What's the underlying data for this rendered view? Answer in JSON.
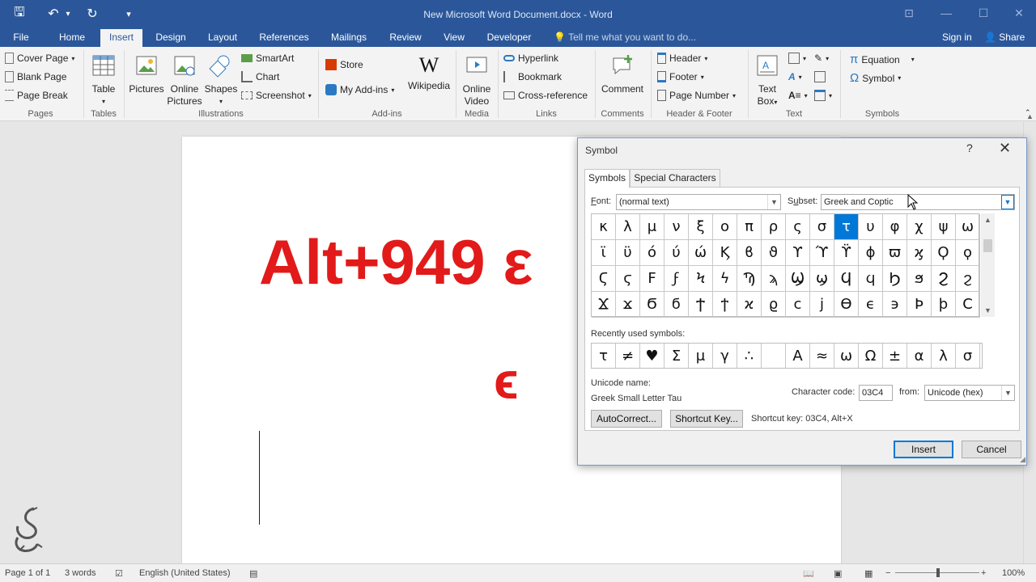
{
  "window": {
    "title": "New Microsoft Word Document.docx - Word"
  },
  "qat": {
    "save": "🖫",
    "undo": "↶",
    "redo": "↻",
    "customize": "▾"
  },
  "tabs": [
    "File",
    "Home",
    "Insert",
    "Design",
    "Layout",
    "References",
    "Mailings",
    "Review",
    "View",
    "Developer"
  ],
  "tell_me": "Tell me what you want to do...",
  "sign_in": "Sign in",
  "share": "Share",
  "ribbon": {
    "pages": {
      "label": "Pages",
      "cover_page": "Cover Page",
      "blank_page": "Blank Page",
      "page_break": "Page Break"
    },
    "tables": {
      "label": "Tables",
      "table": "Table"
    },
    "illustrations": {
      "label": "Illustrations",
      "pictures": "Pictures",
      "online_pictures_1": "Online",
      "online_pictures_2": "Pictures",
      "shapes": "Shapes",
      "smartart": "SmartArt",
      "chart": "Chart",
      "screenshot": "Screenshot"
    },
    "addins": {
      "label": "Add-ins",
      "store": "Store",
      "my_addins": "My Add-ins",
      "wikipedia": "Wikipedia"
    },
    "media": {
      "label": "Media",
      "online_video_1": "Online",
      "online_video_2": "Video"
    },
    "links": {
      "label": "Links",
      "hyperlink": "Hyperlink",
      "bookmark": "Bookmark",
      "cross_reference": "Cross-reference"
    },
    "comments": {
      "label": "Comments",
      "comment": "Comment"
    },
    "header_footer": {
      "label": "Header & Footer",
      "header": "Header",
      "footer": "Footer",
      "page_number": "Page Number"
    },
    "text": {
      "label": "Text",
      "text_box_1": "Text",
      "text_box_2": "Box"
    },
    "symbols": {
      "label": "Symbols",
      "equation": "Equation",
      "symbol": "Symbol"
    }
  },
  "document": {
    "line1": "Alt+949 ε",
    "line2": "ϵ"
  },
  "dialog": {
    "title": "Symbol",
    "help": "?",
    "close": "✕",
    "tabs": [
      "Symbols",
      "Special Characters"
    ],
    "font_label": "Font:",
    "font_value": "(normal text)",
    "subset_label": "Subset:",
    "subset_value": "Greek and Coptic",
    "grid": [
      [
        "κ",
        "λ",
        "μ",
        "ν",
        "ξ",
        "ο",
        "π",
        "ρ",
        "ς",
        "σ",
        "τ",
        "υ",
        "φ",
        "χ",
        "ψ",
        "ω"
      ],
      [
        "ϊ",
        "ϋ",
        "ό",
        "ύ",
        "ώ",
        "Ϗ",
        "ϐ",
        "ϑ",
        "ϒ",
        "ϓ",
        "ϔ",
        "ϕ",
        "ϖ",
        "ϗ",
        "Ϙ",
        "ϙ"
      ],
      [
        "Ϛ",
        "ϛ",
        "Ϝ",
        "ϝ",
        "Ϟ",
        "ϟ",
        "Ϡ",
        "ϡ",
        "Ϣ",
        "ϣ",
        "Ϥ",
        "ϥ",
        "Ϧ",
        "ϧ",
        "Ϩ",
        "ϩ"
      ],
      [
        "Ϫ",
        "ϫ",
        "Ϭ",
        "ϭ",
        "Ϯ",
        "ϯ",
        "ϰ",
        "ϱ",
        "ϲ",
        "ϳ",
        "ϴ",
        "ϵ",
        "϶",
        "Ϸ",
        "ϸ",
        "Ϲ"
      ]
    ],
    "selected_symbol": "τ",
    "recent_label": "Recently used symbols:",
    "recent": [
      "τ",
      "≠",
      "♥",
      "Σ",
      "μ",
      "γ",
      "∴",
      "",
      "Α",
      "≈",
      "ω",
      "Ω",
      "±",
      "α",
      "λ",
      "σ"
    ],
    "unicode_name_label": "Unicode name:",
    "unicode_name": "Greek Small Letter Tau",
    "char_code_label": "Character code:",
    "char_code": "03C4",
    "from_label": "from:",
    "from_value": "Unicode (hex)",
    "autocorrect": "AutoCorrect...",
    "shortcut_key_btn": "Shortcut Key...",
    "shortcut_text": "Shortcut key: 03C4, Alt+X",
    "insert": "Insert",
    "cancel": "Cancel"
  },
  "status": {
    "page": "Page 1 of 1",
    "words": "3 words",
    "language": "English (United States)",
    "zoom": "100%"
  },
  "colors": {
    "brand": "#2b579a",
    "accent": "#0078d7",
    "doc_text": "#e21a1a"
  }
}
